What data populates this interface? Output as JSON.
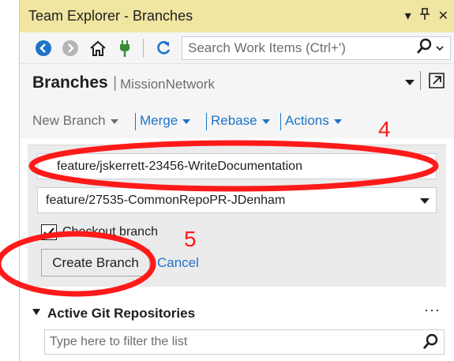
{
  "window": {
    "title": "Team Explorer - Branches",
    "controls": [
      "▾",
      "⊥",
      "✕"
    ]
  },
  "toolbar": {
    "search_placeholder": "Search Work Items (Ctrl+')"
  },
  "header": {
    "title": "Branches",
    "separator": "|",
    "subtitle": "MissionNetwork"
  },
  "actions": [
    {
      "label": "New Branch",
      "color": "#6d6d6d"
    },
    {
      "label": "Merge",
      "color": "#1e73c8"
    },
    {
      "label": "Rebase",
      "color": "#1e73c8"
    },
    {
      "label": "Actions",
      "color": "#1e73c8"
    }
  ],
  "form": {
    "branch_name_value": "feature/jskerrett-23456-WriteDocumentation",
    "base_branch_selected": "feature/27535-CommonRepoPR-JDenham",
    "checkout_label": "Checkout branch",
    "checkout_checked": true,
    "create_button_label": "Create Branch",
    "cancel_label": "Cancel"
  },
  "repos": {
    "title": "Active Git Repositories",
    "more": "···",
    "filter_placeholder": "Type here to filter the list"
  },
  "annotations": {
    "step_4": "4",
    "step_5": "5",
    "color": "#ff1a1a"
  },
  "colors": {
    "titlebar": "#f0e5a1",
    "link": "#1e73c8",
    "panel": "#ebebeb"
  }
}
